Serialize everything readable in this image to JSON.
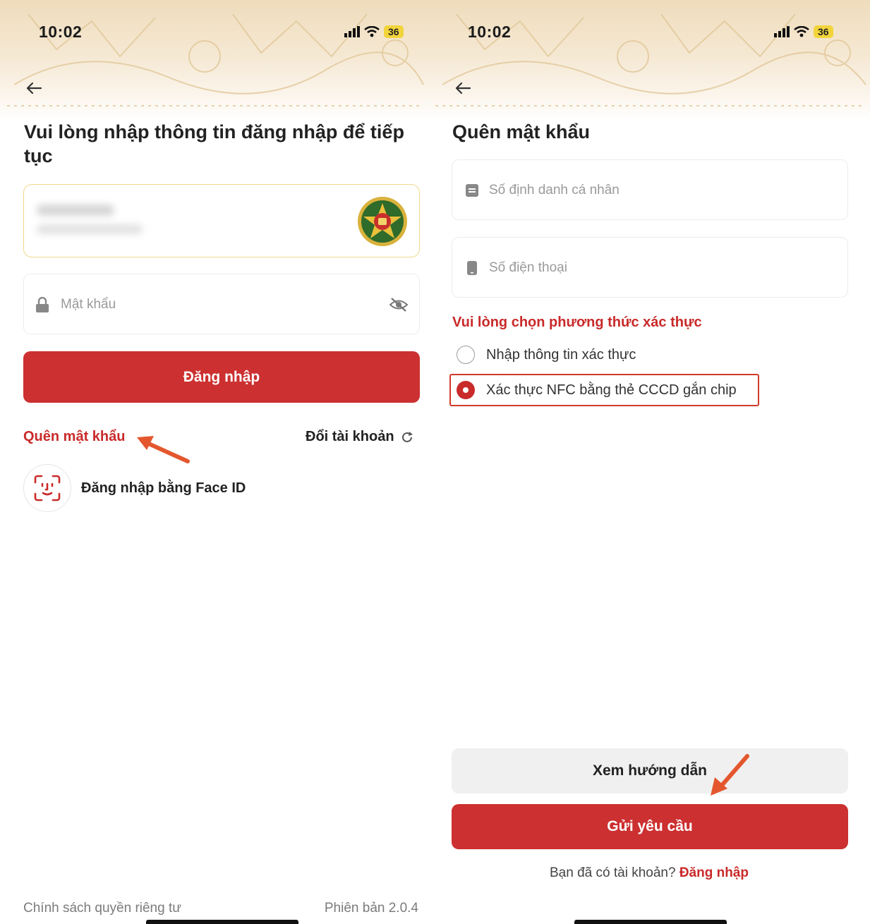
{
  "left_screen": {
    "status": {
      "time": "10:02",
      "battery": "36"
    },
    "heading": "Vui lòng nhập thông tin đăng nhập để tiếp tục",
    "password_placeholder": "Mật khẩu",
    "login_button": "Đăng nhập",
    "forgot_password_link": "Quên mật khẩu",
    "switch_account_link": "Đổi tài khoản",
    "face_id_label": "Đăng nhập bằng Face ID",
    "privacy_policy_link": "Chính sách quyền riêng tư",
    "version_label": "Phiên bản 2.0.4"
  },
  "right_screen": {
    "status": {
      "time": "10:02",
      "battery": "36"
    },
    "heading": "Quên mật khẩu",
    "id_placeholder": "Số định danh cá nhân",
    "phone_placeholder": "Số điện thoại",
    "method_prompt": "Vui lòng chọn phương thức xác thực",
    "options": [
      {
        "label": "Nhập thông tin xác thực",
        "selected": false
      },
      {
        "label": "Xác thực NFC bằng thẻ CCCD gắn chip",
        "selected": true
      }
    ],
    "guide_button": "Xem hướng dẫn",
    "submit_button": "Gửi yêu cầu",
    "account_prompt": "Bạn đã có tài khoản?",
    "login_link": "Đăng nhập"
  },
  "colors": {
    "primary_red": "#cc3030",
    "header_beige": "#efdcbc",
    "highlight_arrow": "#e4572e",
    "selected_option_outline": "#d23a2a"
  },
  "icons": {
    "back": "arrow-left-icon",
    "signal": "signal-bars-icon",
    "wifi": "wifi-icon",
    "lock": "lock-icon",
    "hide_password": "eye-slash-icon",
    "refresh": "refresh-icon",
    "face_id": "face-id-icon",
    "id_card": "id-card-icon",
    "phone": "phone-icon",
    "emblem": "police-emblem-icon"
  }
}
